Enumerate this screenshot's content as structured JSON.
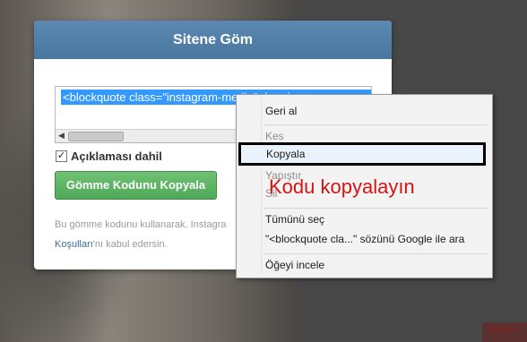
{
  "dialog": {
    "title": "Sitene Göm",
    "embed_code": "<blockquote class=\"instagram-media\" data-instgrm-cap",
    "checkbox_label": "Açıklaması dahil",
    "checkbox_checked": true,
    "copy_button_label": "Gömme Kodunu Kopyala",
    "footer_text_line1": "Bu gömme kodunu kullanarak, Instagra",
    "footer_link": "Koşulları",
    "footer_text_line2": "'nı kabul edersin."
  },
  "context_menu": {
    "items": [
      {
        "label": "Geri al",
        "enabled": true
      },
      {
        "label": "Kes",
        "enabled": false
      },
      {
        "label": "Kopyala",
        "enabled": true,
        "highlighted": true
      },
      {
        "label": "Yapıştır",
        "enabled": false
      },
      {
        "label": "Sil",
        "enabled": false
      },
      {
        "label": "Tümünü seç",
        "enabled": true
      },
      {
        "label": "\"<blockquote cla...\" sözünü Google ile ara",
        "enabled": true
      },
      {
        "label": "Öğeyi incele",
        "enabled": true
      }
    ]
  },
  "annotation": "Kodu kopyalayın",
  "background_corner_text": "Uygun",
  "colors": {
    "header": "#4f7ea7",
    "button": "#5cb060",
    "selection": "#3399ff",
    "annotation": "#d41414"
  }
}
